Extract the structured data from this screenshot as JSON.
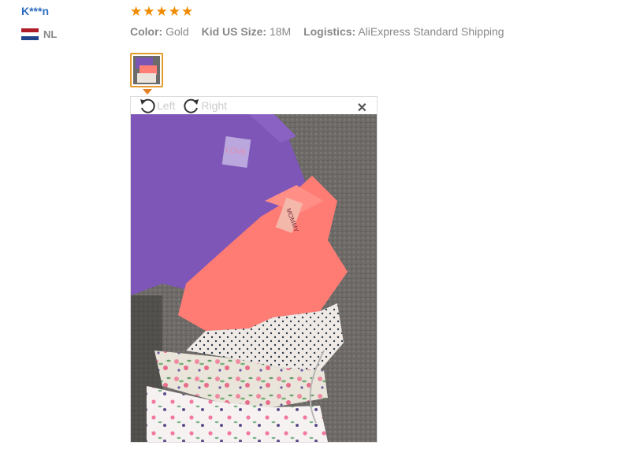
{
  "review": {
    "user_name": "K***n",
    "country_code": "NL",
    "flag_colors": [
      "#ae1c28",
      "#ffffff",
      "#21468b"
    ],
    "rating_stars": 5,
    "rating_color": "#f08b00",
    "attrs": [
      {
        "key": "Color:",
        "value": "Gold"
      },
      {
        "key": "Kid US Size:",
        "value": "18M"
      },
      {
        "key": "Logistics:",
        "value": "AliExpress Standard Shipping"
      }
    ]
  },
  "viewer": {
    "rotate_left_label": "Left",
    "rotate_right_label": "Right",
    "close_icon": "close-icon",
    "thumbnail_border_color": "#e69b2f"
  }
}
